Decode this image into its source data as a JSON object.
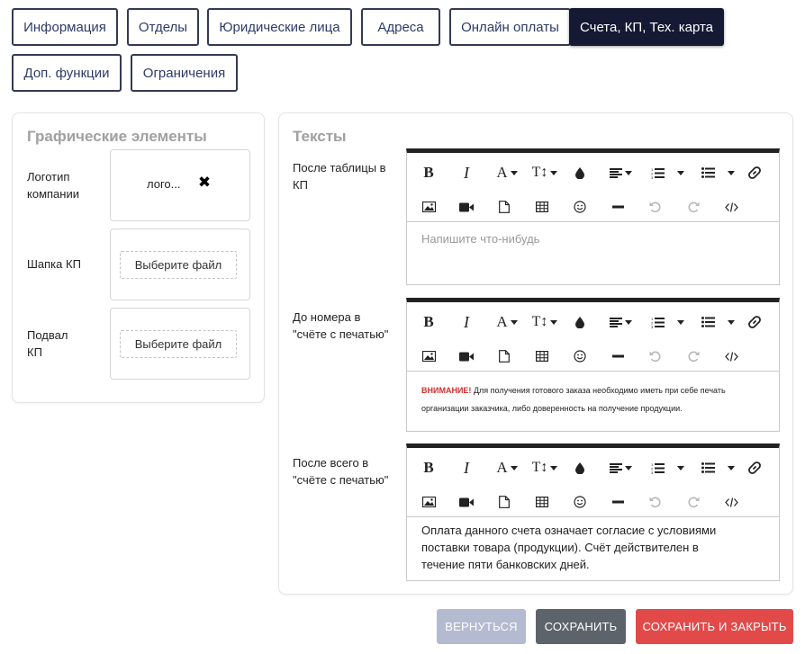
{
  "tabs": [
    {
      "label": "Информация",
      "active": false
    },
    {
      "label": "Отделы",
      "active": false
    },
    {
      "label": "Юридические лица",
      "active": false
    },
    {
      "label": "Адреса",
      "active": false
    },
    {
      "label": "Онлайн оплаты",
      "active": false
    },
    {
      "label": "Счета, КП, Тех. карта",
      "active": true
    },
    {
      "label": "Доп. функции",
      "active": false
    },
    {
      "label": "Ограничения",
      "active": false
    }
  ],
  "graphics": {
    "title": "Графические элементы",
    "logo": {
      "label_line1": "Логотип",
      "label_line2": "компании",
      "file_name": "лого..."
    },
    "header": {
      "label": "Шапка КП",
      "button": "Выберите файл"
    },
    "footer": {
      "label_line1": "Подвал",
      "label_line2": "КП",
      "button": "Выберите файл"
    }
  },
  "texts": {
    "title": "Тексты",
    "editors": [
      {
        "label_line1": "После таблицы в",
        "label_line2": "КП",
        "placeholder": "Напишите что-нибудь",
        "content": ""
      },
      {
        "label_line1": "До номера в",
        "label_line2": "\"счёте с печатью\"",
        "warning_strong": "ВНИМАНИЕ!",
        "warning_text": " Для получения готового заказа необходимо иметь при себе печать организации заказчика, либо доверенность на получение продукции."
      },
      {
        "label_line1": "После всего в",
        "label_line2": "\"счёте с печатью\"",
        "content": "Оплата данного счета означает согласие с условиями поставки товара (продукции). Счёт действителен в течение пяти банковских дней."
      }
    ]
  },
  "toolbar_icons": [
    "bold-icon",
    "italic-icon",
    "font-color-icon",
    "font-size-icon",
    "highlight-icon",
    "align-icon",
    "ordered-list-icon",
    "unordered-list-icon",
    "link-icon",
    "image-icon",
    "video-icon",
    "file-icon",
    "table-icon",
    "emoji-icon",
    "horizontal-rule-icon",
    "undo-icon",
    "redo-icon",
    "code-view-icon"
  ],
  "buttons": {
    "back": {
      "label": "ВЕРНУТЬСЯ",
      "color": "#b4bad0"
    },
    "save": {
      "label": "СОХРАНИТЬ",
      "color": "#5c636a"
    },
    "save_close": {
      "label": "СОХРАНИТЬ И ЗАКРЫТЬ",
      "color": "#e24a4a"
    }
  },
  "colors": {
    "active_tab": "#151933",
    "tab_border": "#343a55",
    "warning": "#d32f2f"
  }
}
